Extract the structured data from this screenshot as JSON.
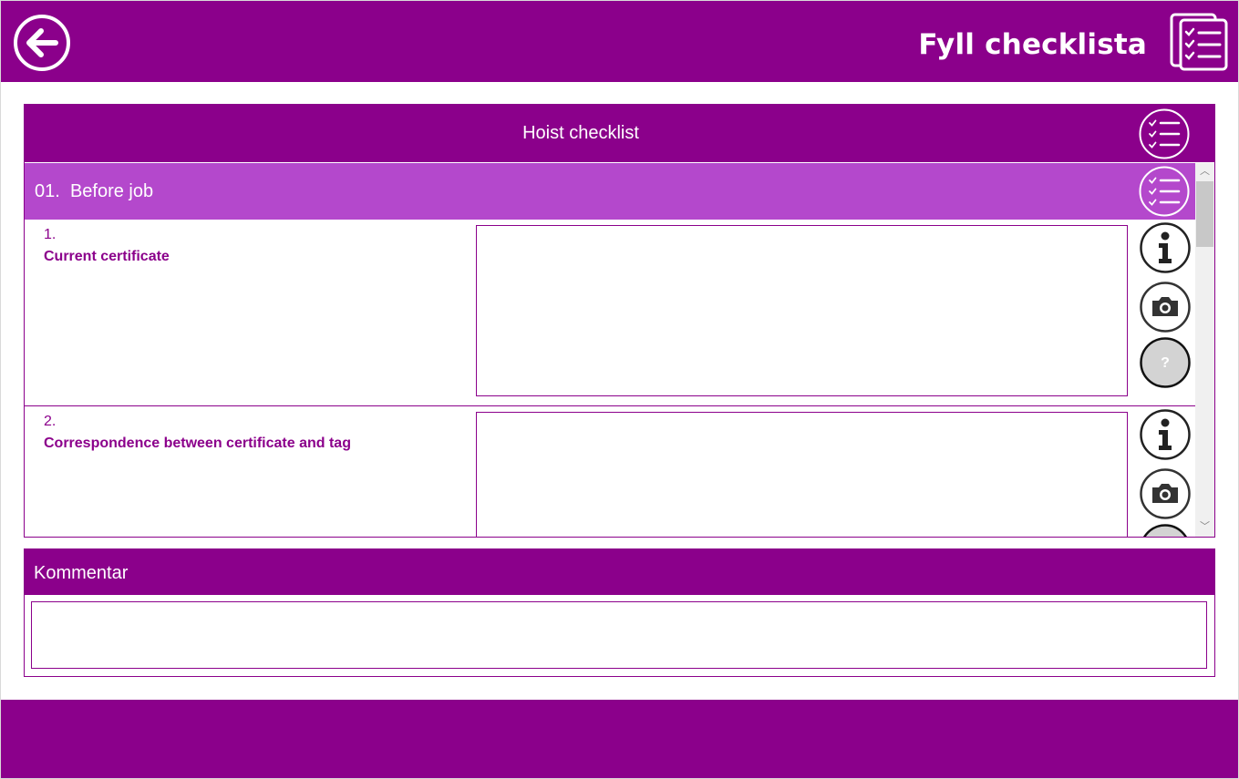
{
  "colors": {
    "primary": "#8b008b",
    "section": "#b448cc",
    "border": "#8b008b",
    "scrollbar": "#f0f0f0",
    "disabled_button": "#d3d3d3"
  },
  "header": {
    "title": "Fyll checklista",
    "back_icon": "arrow-left-circle-icon",
    "page_icon": "checklist-documents-icon"
  },
  "checklist": {
    "title": "Hoist checklist",
    "section": {
      "number": "01.",
      "title": "Before job"
    },
    "items": [
      {
        "number": "1.",
        "label": "Current certificate",
        "answer": ""
      },
      {
        "number": "2.",
        "label": "Correspondence between certificate and tag",
        "answer": ""
      }
    ],
    "buttons": {
      "info_icon": "info-icon",
      "camera_icon": "camera-icon",
      "status_icon": "question-icon",
      "status_label": "?"
    }
  },
  "comment": {
    "title": "Kommentar",
    "value": ""
  }
}
